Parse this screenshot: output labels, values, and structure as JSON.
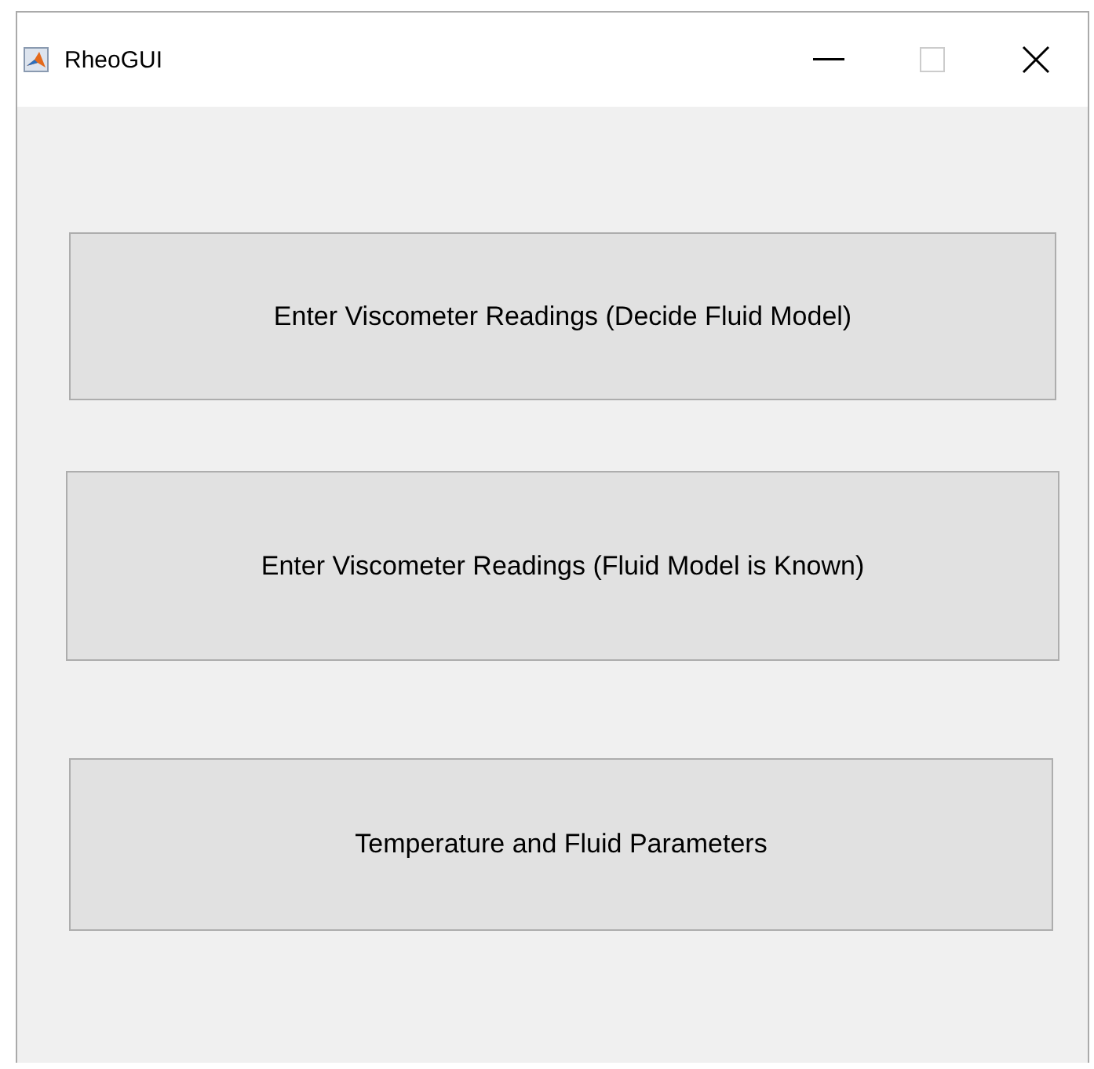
{
  "window": {
    "title": "RheoGUI",
    "maximize_disabled": true
  },
  "buttons": [
    {
      "label": "Enter Viscometer Readings (Decide Fluid Model)"
    },
    {
      "label": "Enter Viscometer Readings (Fluid Model is Known)"
    },
    {
      "label": "Temperature and Fluid Parameters"
    }
  ]
}
